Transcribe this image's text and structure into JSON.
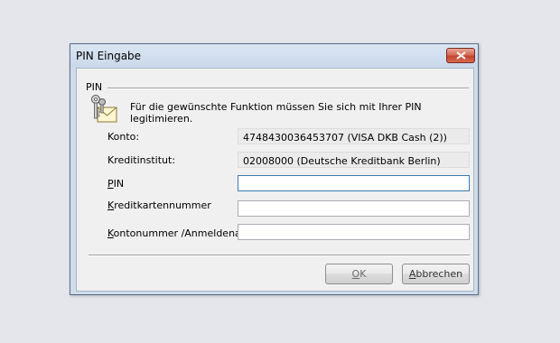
{
  "window": {
    "title": "PIN Eingabe"
  },
  "group": {
    "label": "PIN",
    "info": "Für die gewünschte Funktion müssen Sie sich mit Ihrer PIN legitimieren.",
    "icon": "keys-icon"
  },
  "fields": {
    "konto": {
      "label": "Konto:",
      "value": "4748430036453707 (VISA DKB Cash (2))"
    },
    "kreditinstitut": {
      "label": "Kreditinstitut:",
      "value": "02008000 (Deutsche Kreditbank Berlin)"
    },
    "pin": {
      "label_accel": "P",
      "label_rest": "IN",
      "value": ""
    },
    "kreditkartennummer": {
      "label_accel": "K",
      "label_rest": "reditkartennummer",
      "value": ""
    },
    "kontonummer": {
      "label_accel": "K",
      "label_rest": "ontonummer /Anmeldename",
      "value": ""
    }
  },
  "buttons": {
    "ok_accel": "O",
    "ok_rest": "K",
    "cancel_accel": "A",
    "cancel_rest": "bbrechen"
  },
  "colors": {
    "background": "#e4e6ec",
    "window_frame": "#cfdcec",
    "close_button": "#c2452e",
    "client_area": "#f0f0f0"
  }
}
